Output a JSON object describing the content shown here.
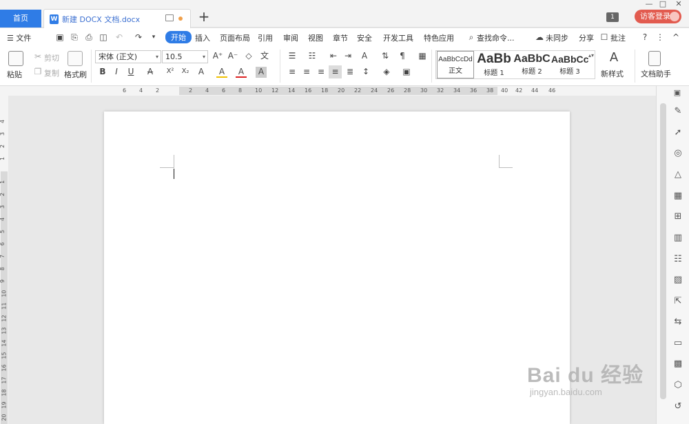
{
  "titlebar": {
    "home_tab": "首页",
    "doc_tab_icon": "W",
    "doc_tab_title": "新建 DOCX 文档.docx",
    "add_tab": "+",
    "badge_count": "1",
    "login_label": "访客登录",
    "window_controls": {
      "minimize": "—",
      "maximize": "□",
      "close": "✕"
    }
  },
  "menubar": {
    "file": "☰ 文件",
    "tabs": [
      "开始",
      "插入",
      "页面布局",
      "引用",
      "审阅",
      "视图",
      "章节",
      "安全",
      "开发工具",
      "特色应用"
    ],
    "search": "查找命令...",
    "sync": "未同步",
    "share": "分享",
    "comment": "批注",
    "help": "?",
    "more": "⋮",
    "collapse": "^"
  },
  "ribbon": {
    "paste": "粘贴",
    "cut": "剪切",
    "copy": "复制",
    "format_painter": "格式刷",
    "font_name": "宋体 (正文)",
    "font_size": "10.5",
    "styles": [
      {
        "sample": "AaBbCcDd",
        "name": "正文"
      },
      {
        "sample": "AaBb",
        "name": "标题 1"
      },
      {
        "sample": "AaBbC",
        "name": "标题 2"
      },
      {
        "sample": "AaBbCc",
        "name": "标题 3"
      }
    ],
    "new_style": "新样式",
    "doc_assistant": "文档助手",
    "format_buttons": [
      "B",
      "I",
      "U",
      "A",
      "X²",
      "X₂",
      "A",
      "A",
      "A",
      "A"
    ]
  },
  "ruler": {
    "h_ticks": [
      "6",
      "4",
      "2",
      "2",
      "4",
      "6",
      "8",
      "10",
      "12",
      "14",
      "16",
      "18",
      "20",
      "22",
      "24",
      "26",
      "28",
      "30",
      "32",
      "34",
      "36",
      "38",
      "40",
      "42",
      "44",
      "46"
    ],
    "v_ticks": [
      "4",
      "3",
      "2",
      "1",
      "1",
      "2",
      "3",
      "4",
      "5",
      "6",
      "7",
      "8",
      "9",
      "10",
      "11",
      "12",
      "13",
      "14",
      "15",
      "16",
      "17",
      "18",
      "19",
      "20"
    ]
  },
  "watermark": {
    "big": "Bai du 经验",
    "small": "jingyan.baidu.com"
  }
}
